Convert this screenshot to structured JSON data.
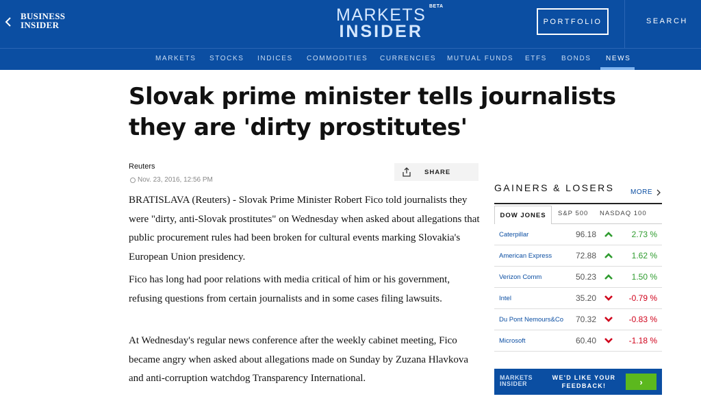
{
  "header": {
    "back_icon": "chevron-left-icon",
    "bi_logo_line1": "BUSINESS",
    "bi_logo_line2": "INSIDER",
    "mi_logo_line1": "MARKETS",
    "mi_logo_line2": "INSIDER",
    "mi_beta": "BETA",
    "portfolio_label": "PORTFOLIO",
    "search_label": "SEARCH",
    "brand_color": "#0b4ea2"
  },
  "nav": {
    "items": [
      "MARKETS",
      "STOCKS",
      "INDICES",
      "COMMODITIES",
      "CURRENCIES",
      "MUTUAL FUNDS",
      "ETFS",
      "BONDS",
      "NEWS"
    ],
    "active": "NEWS"
  },
  "article": {
    "headline": "Slovak prime minister tells journalists they are 'dirty prostitutes'",
    "source": "Reuters",
    "date": "Nov. 23, 2016, 12:56 PM",
    "share_label": "SHARE",
    "paragraphs": [
      "BRATISLAVA (Reuters) - Slovak Prime Minister Robert Fico told journalists they were \"dirty, anti-Slovak prostitutes\" on Wednesday when asked about allegations that public procurement rules had been broken for cultural events marking Slovakia's European Union presidency.",
      "Fico has long had poor relations with media critical of him or his government, refusing questions from certain journalists and in some cases filing lawsuits.",
      "At Wednesday's regular news conference after the weekly cabinet meeting, Fico became angry when asked about allegations made on Sunday by Zuzana Hlavkova and anti-corruption watchdog Transparency International."
    ]
  },
  "sidebar": {
    "title": "GAINERS & LOSERS",
    "more_label": "MORE",
    "tabs": [
      "DOW JONES",
      "S&P 500",
      "NASDAQ 100"
    ],
    "active_tab": "DOW JONES",
    "rows": [
      {
        "name": "Caterpillar",
        "price": "96.18",
        "direction": "up",
        "change": "2.73 %"
      },
      {
        "name": "American Express",
        "price": "72.88",
        "direction": "up",
        "change": "1.62 %"
      },
      {
        "name": "Verizon Comm",
        "price": "50.23",
        "direction": "up",
        "change": "1.50 %"
      },
      {
        "name": "Intel",
        "price": "35.20",
        "direction": "down",
        "change": "-0.79 %"
      },
      {
        "name": "Du Pont Nemours&Co",
        "price": "70.32",
        "direction": "down",
        "change": "-0.83 %"
      },
      {
        "name": "Microsoft",
        "price": "60.40",
        "direction": "down",
        "change": "-1.18 %"
      }
    ],
    "up_color": "#2e9b2e",
    "down_color": "#d0021b"
  },
  "feedback_ad": {
    "logo_line1": "MARKETS",
    "logo_line2": "INSIDER",
    "text": "WE'D LIKE YOUR FEEDBACK!",
    "button": "›"
  }
}
